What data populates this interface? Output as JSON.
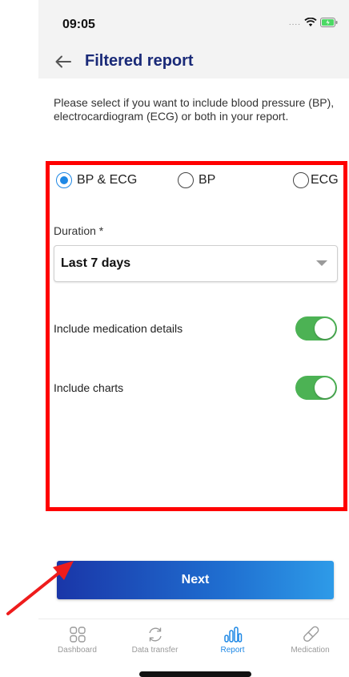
{
  "status_bar": {
    "time": "09:05",
    "signal_dots": "....",
    "battery_color": "#4cd964"
  },
  "header": {
    "title": "Filtered report",
    "back_icon": "back-arrow-icon"
  },
  "intro_text": "Please select if you want to include blood pressure (BP), electrocardiogram (ECG) or both in your report.",
  "report_type": {
    "options": [
      {
        "label": "BP & ECG",
        "selected": true
      },
      {
        "label": "BP",
        "selected": false
      },
      {
        "label": "ECG",
        "selected": false
      }
    ]
  },
  "duration": {
    "label": "Duration *",
    "value": "Last 7 days"
  },
  "toggles": {
    "medication": {
      "label": "Include medication details",
      "on": true
    },
    "charts": {
      "label": "Include charts",
      "on": true
    }
  },
  "next_label": "Next",
  "tabs": [
    {
      "label": "Dashboard",
      "icon": "grid-icon",
      "active": false
    },
    {
      "label": "Data transfer",
      "icon": "sync-icon",
      "active": false
    },
    {
      "label": "Report",
      "icon": "report-bars-icon",
      "active": true
    },
    {
      "label": "Medication",
      "icon": "pill-icon",
      "active": false
    }
  ],
  "colors": {
    "accent": "#1e88e5",
    "title": "#1a2a78",
    "toggle_on": "#4cb254",
    "highlight": "#ff0000"
  }
}
